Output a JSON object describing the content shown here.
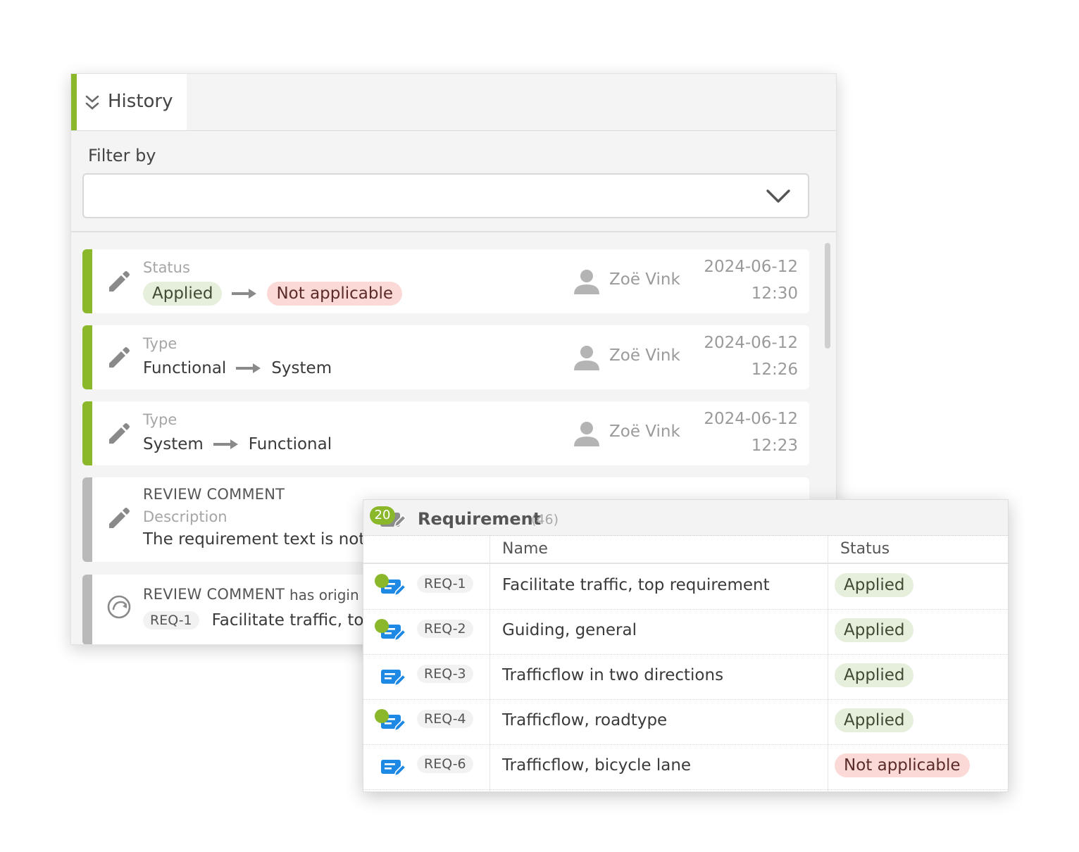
{
  "history": {
    "tab_label": "History",
    "filter_label": "Filter by",
    "filter_value": "",
    "entries": [
      {
        "field": "Status",
        "from": "Applied",
        "to": "Not applicable",
        "author": "Zoë Vink",
        "date": "2024-06-12",
        "time": "12:30"
      },
      {
        "field": "Type",
        "from": "Functional",
        "to": "System",
        "author": "Zoë Vink",
        "date": "2024-06-12",
        "time": "12:26"
      },
      {
        "field": "Type",
        "from": "System",
        "to": "Functional",
        "author": "Zoë Vink",
        "date": "2024-06-12",
        "time": "12:23"
      }
    ],
    "review_comment": {
      "kind": "REVIEW COMMENT",
      "field": "Description",
      "text": "The requirement text is not"
    },
    "origin_comment": {
      "kind": "REVIEW COMMENT",
      "relation": "has origin",
      "id": "REQ-1",
      "title": "Facilitate traffic, top"
    }
  },
  "requirements": {
    "badge_count": "20",
    "title": "Requirement",
    "total": "(46)",
    "columns": {
      "name": "Name",
      "status": "Status"
    },
    "rows": [
      {
        "id": "REQ-1",
        "name": "Facilitate traffic, top requirement",
        "status": "Applied",
        "status_kind": "green",
        "has_dot": true
      },
      {
        "id": "REQ-2",
        "name": "Guiding, general",
        "status": "Applied",
        "status_kind": "green",
        "has_dot": true
      },
      {
        "id": "REQ-3",
        "name": "Trafficflow in two directions",
        "status": "Applied",
        "status_kind": "green",
        "has_dot": false
      },
      {
        "id": "REQ-4",
        "name": "Trafficflow, roadtype",
        "status": "Applied",
        "status_kind": "green",
        "has_dot": true
      },
      {
        "id": "REQ-6",
        "name": "Trafficflow, bicycle lane",
        "status": "Not applicable",
        "status_kind": "red",
        "has_dot": false
      }
    ]
  },
  "colors": {
    "accent": "#8bb82a",
    "req_icon": "#1e88e5",
    "applied_bg": "#e5efdc",
    "not_applicable_bg": "#fbd9d6"
  },
  "icons": {
    "tab": "double-chevron-down-icon",
    "select": "chevron-down-icon",
    "edit": "pencil-icon",
    "user": "person-icon",
    "origin": "origin-icon",
    "requirement": "requirement-icon"
  }
}
